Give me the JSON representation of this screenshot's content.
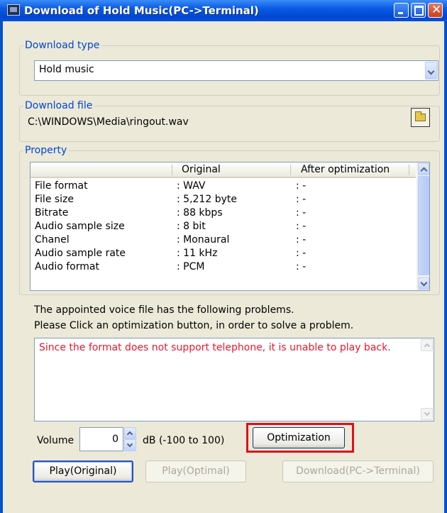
{
  "window": {
    "title": "Download of Hold Music(PC->Terminal)"
  },
  "download_type": {
    "label": "Download type",
    "selected": "Hold music"
  },
  "download_file": {
    "label": "Download file",
    "path": "C:\\WINDOWS\\Media\\ringout.wav"
  },
  "property": {
    "label": "Property",
    "columns": [
      "",
      "Original",
      "After optimization"
    ],
    "rows": [
      {
        "name": "File format",
        "original": ": WAV",
        "after": ": -"
      },
      {
        "name": "File size",
        "original": ": 5,212 byte",
        "after": ": -"
      },
      {
        "name": "Bitrate",
        "original": ": 88 kbps",
        "after": ": -"
      },
      {
        "name": "Audio sample size",
        "original": ": 8 bit",
        "after": ": -"
      },
      {
        "name": "Chanel",
        "original": ": Monaural",
        "after": ": -"
      },
      {
        "name": "Audio sample rate",
        "original": ": 11 kHz",
        "after": ": -"
      },
      {
        "name": "Audio format",
        "original": ": PCM",
        "after": ": -"
      }
    ]
  },
  "message": {
    "line1": "The appointed voice file has the following problems.",
    "line2": "Please Click an optimization button, in order to solve a problem.",
    "problem": "Since the format does not support telephone, it is unable to play back."
  },
  "volume": {
    "label": "Volume",
    "value": "0",
    "range_label": "dB (-100 to 100)"
  },
  "buttons": {
    "optimization": "Optimization",
    "play_original": "Play(Original)",
    "play_optimal": "Play(Optimal)",
    "download": "Download(PC->Terminal)"
  },
  "colors": {
    "title_bar": "#0a5ae4",
    "group_label": "#0046d5",
    "problem_text": "#e8182c",
    "highlight": "#e0101c"
  }
}
